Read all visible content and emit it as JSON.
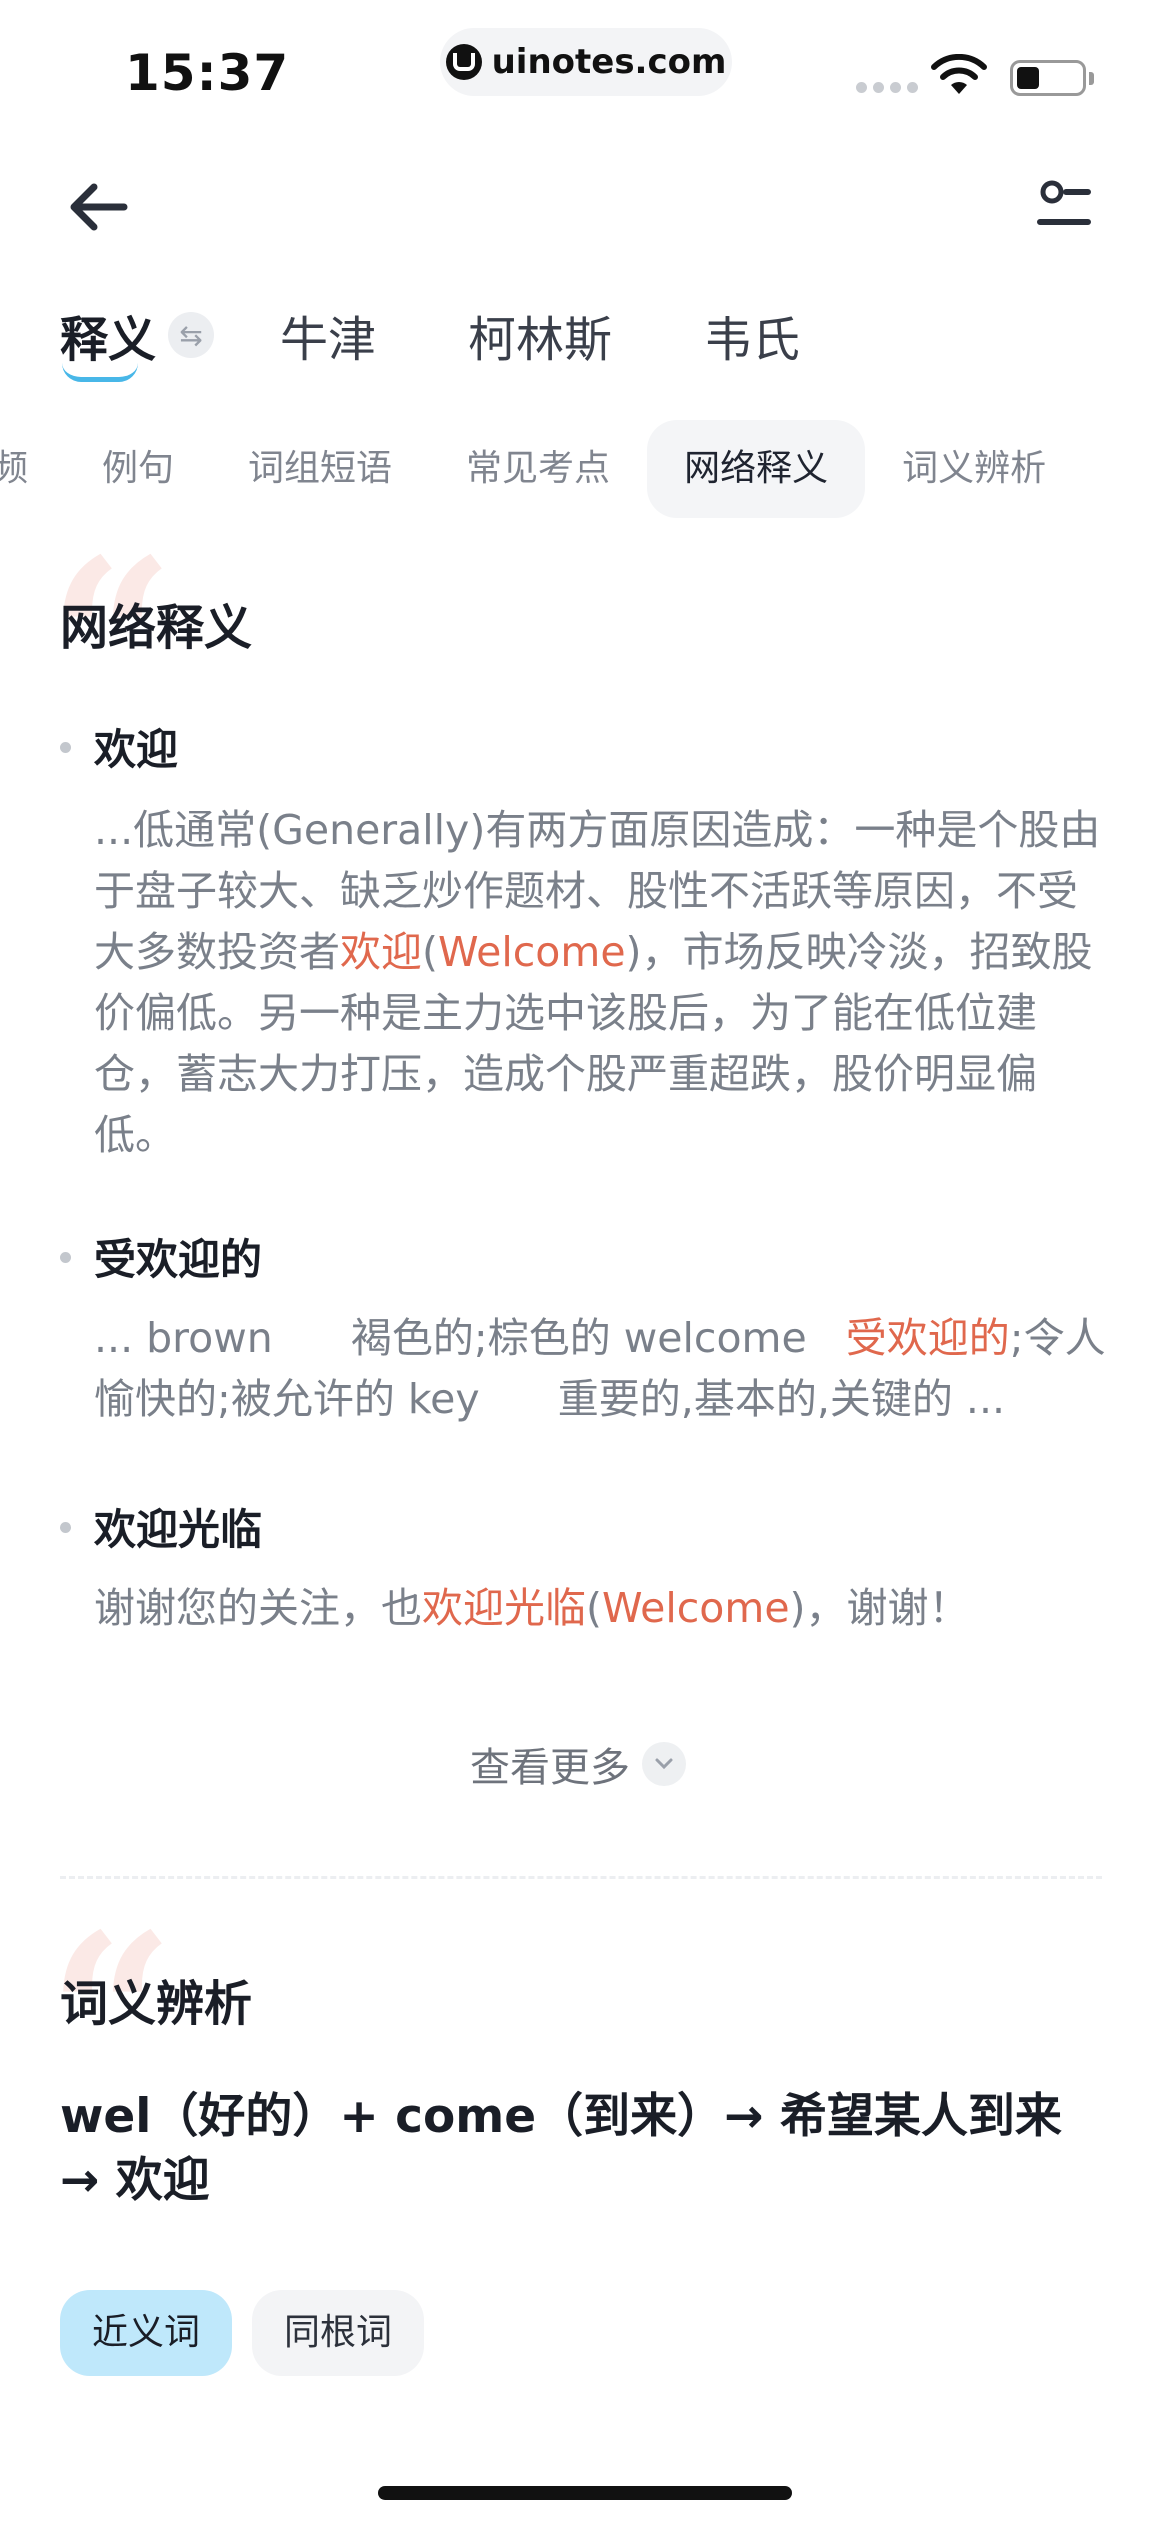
{
  "status_bar": {
    "time": "15:37",
    "url": "uinotes.com"
  },
  "icons": {
    "back": "back-arrow-icon",
    "filter": "filter-settings-icon",
    "swap": "swap-icon",
    "more": "chevron-down-icon",
    "wifi": "wifi-icon",
    "battery": "battery-icon"
  },
  "dict_tabs": [
    "释义",
    "牛津",
    "柯林斯",
    "韦氏"
  ],
  "section_tabs": [
    "考频",
    "例句",
    "词组短语",
    "常见考点",
    "网络释义",
    "词义辨析"
  ],
  "active_section_tab": "网络释义",
  "web_defs": {
    "title": "网络释义",
    "items": [
      {
        "head": "欢迎",
        "parts": [
          {
            "t": "...低通常(Generally)有两方面原因造成：一种是个股由于盘子较大、缺乏炒作题材、股性不活跃等原因，不受大多数投资者",
            "hl": false
          },
          {
            "t": "欢迎",
            "hl": true
          },
          {
            "t": "(",
            "hl": false
          },
          {
            "t": "Welcome",
            "hl": true
          },
          {
            "t": ")，市场反映冷淡，招致股价偏低。另一种是主力选中该股后，为了能在低位建仓，蓄志大力打压，造成个股严重超跌，股价明显偏低。",
            "hl": false
          }
        ]
      },
      {
        "head": "受欢迎的",
        "parts": [
          {
            "t": "... brown      褐色的;棕色的 welcome   ",
            "hl": false
          },
          {
            "t": "受欢迎的",
            "hl": true
          },
          {
            "t": ";令人愉快的;被允许的 key      重要的,基本的,关键的 ...",
            "hl": false
          }
        ]
      },
      {
        "head": "欢迎光临",
        "parts": [
          {
            "t": "谢谢您的关注，也",
            "hl": false
          },
          {
            "t": "欢迎光临",
            "hl": true
          },
          {
            "t": "(",
            "hl": false
          },
          {
            "t": "Welcome",
            "hl": true
          },
          {
            "t": ")，谢谢！",
            "hl": false
          }
        ]
      }
    ],
    "more_label": "查看更多"
  },
  "synonym": {
    "title": "词义辨析",
    "etymology": "wel（好的）+ come（到来）→ 希望某人到来 → 欢迎",
    "chips": [
      "近义词",
      "同根词"
    ]
  },
  "colors": {
    "highlight": "#e0684d",
    "accent_underline": "#48b7e8",
    "chip_active": "#bfe8fb"
  }
}
